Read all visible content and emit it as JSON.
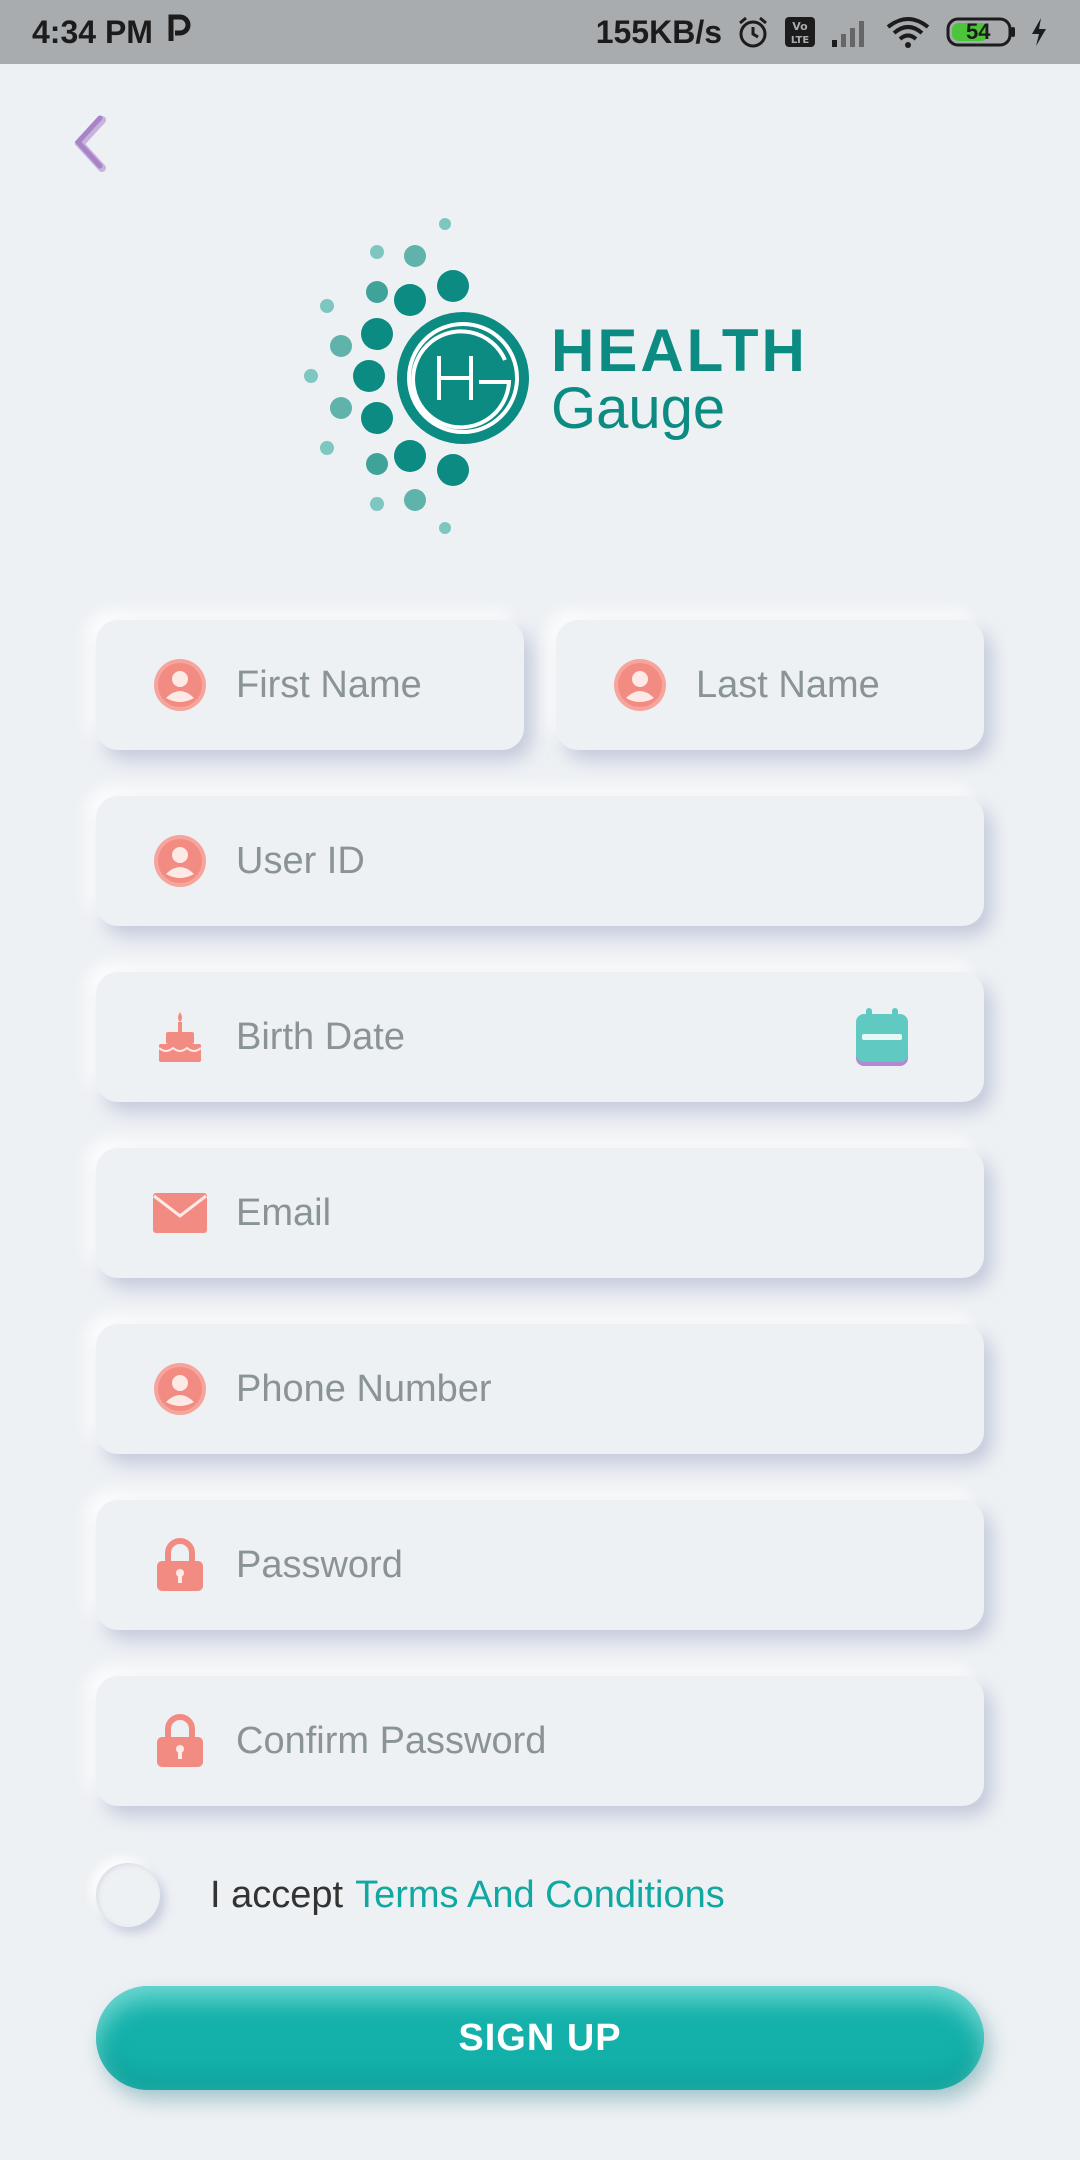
{
  "status_bar": {
    "time": "4:34 PM",
    "carrier_icon": "p-icon",
    "speed": "155KB/s",
    "battery": "54"
  },
  "logo": {
    "title": "HEALTH",
    "subtitle": "Gauge"
  },
  "form": {
    "first_name": {
      "placeholder": "First Name",
      "icon": "user-icon"
    },
    "last_name": {
      "placeholder": "Last Name",
      "icon": "user-icon"
    },
    "user_id": {
      "placeholder": "User ID",
      "icon": "user-icon"
    },
    "birth_date": {
      "placeholder": "Birth Date",
      "icon": "cake-icon",
      "action_icon": "calendar-icon"
    },
    "email": {
      "placeholder": "Email",
      "icon": "mail-icon"
    },
    "phone": {
      "placeholder": "Phone Number",
      "icon": "user-icon"
    },
    "password": {
      "placeholder": "Password",
      "icon": "lock-icon"
    },
    "confirm_password": {
      "placeholder": "Confirm Password",
      "icon": "lock-icon"
    }
  },
  "terms": {
    "prefix": "I accept",
    "link": "Terms And Conditions"
  },
  "signup_label": "SIGN UP",
  "colors": {
    "accent": "#10a8a0",
    "logo": "#0b8b81",
    "icon": "#f28b82",
    "background": "#eef1f4"
  }
}
